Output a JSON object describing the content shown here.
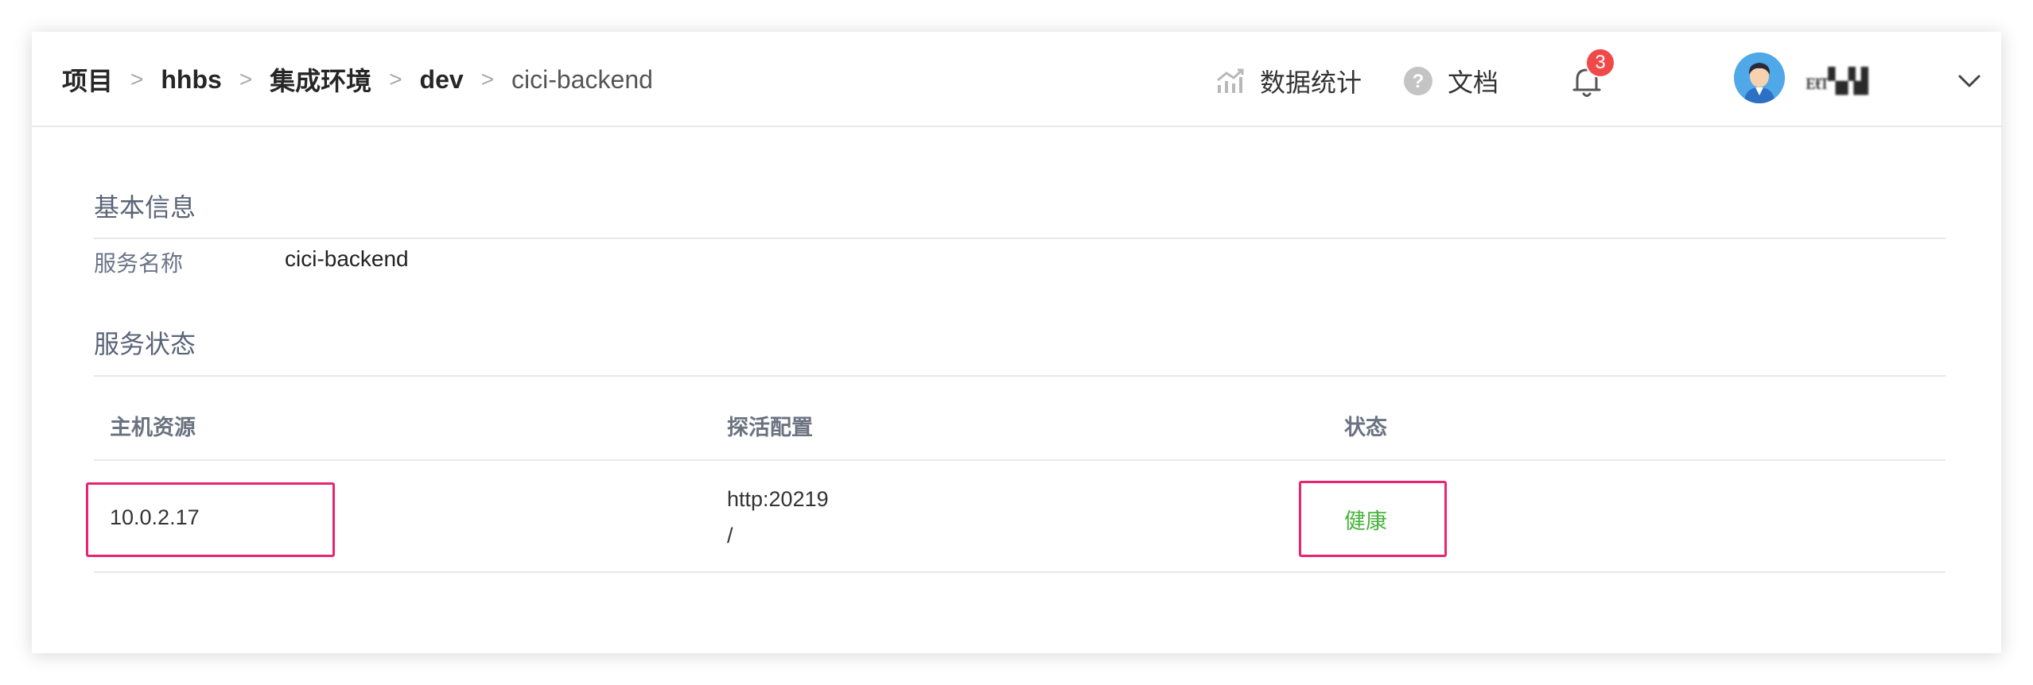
{
  "header": {
    "breadcrumb": [
      {
        "label": "项目"
      },
      {
        "label": "hhbs"
      },
      {
        "label": "集成环境"
      },
      {
        "label": "dev"
      },
      {
        "label": "cici-backend"
      }
    ],
    "separator": ">",
    "stats_label": "数据统计",
    "docs_label": "文档",
    "notifications_count": "3",
    "username": "ᴇᵼᴛ▚▞▟"
  },
  "basic_info": {
    "title": "基本信息",
    "service_name_label": "服务名称",
    "service_name_value": "cici-backend"
  },
  "service_status": {
    "title": "服务状态",
    "columns": [
      "主机资源",
      "探活配置",
      "状态"
    ],
    "rows": [
      {
        "host": "10.0.2.17",
        "probe_line1": "http:20219",
        "probe_line2": "/",
        "status": "健康"
      }
    ]
  },
  "colors": {
    "healthy": "#46b33a",
    "highlight": "#e8266f",
    "badge": "#f04949"
  }
}
